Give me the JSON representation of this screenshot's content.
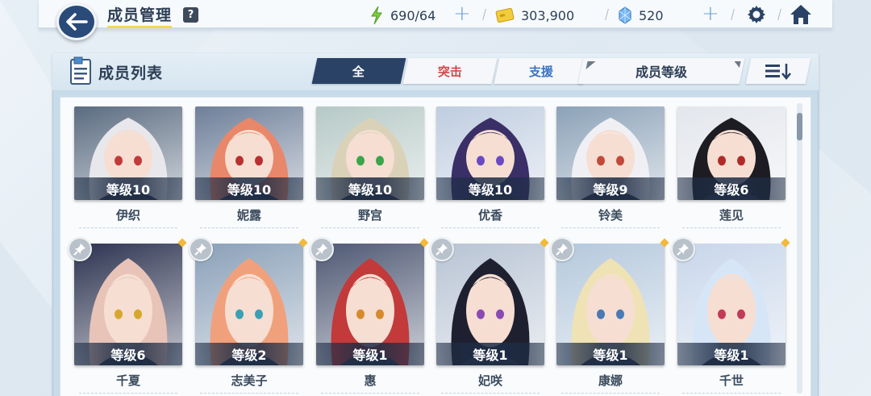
{
  "header": {
    "title": "成员管理",
    "help_label": "?",
    "ap": "690/64",
    "credits": "303,900",
    "gems": "520"
  },
  "panel": {
    "title": "成员列表",
    "tabs": [
      {
        "label": "全"
      },
      {
        "label": "突击"
      },
      {
        "label": "支援"
      }
    ],
    "sort_label": "成员等级"
  },
  "colors": {
    "accent": "#2a4265",
    "striker": "#d14a4a",
    "special": "#3a74c4",
    "badge": "#f2b93a"
  },
  "members": [
    {
      "name": "伊织",
      "level": "等级10",
      "hair": "#e8e8ec",
      "bg": "#5a6b80",
      "eye": "#c23a3a"
    },
    {
      "name": "妮露",
      "level": "等级10",
      "hair": "#e9876a",
      "bg": "#6e7f99",
      "eye": "#b83030"
    },
    {
      "name": "野宫",
      "level": "等级10",
      "hair": "#d9d2b8",
      "bg": "#b6c9c6",
      "eye": "#3aa54a"
    },
    {
      "name": "优香",
      "level": "等级10",
      "hair": "#3b2f68",
      "bg": "#bfcde0",
      "eye": "#6a4ac4"
    },
    {
      "name": "铃美",
      "level": "等级9",
      "hair": "#f0f0f4",
      "bg": "#8ca2b8",
      "eye": "#c24a3a"
    },
    {
      "name": "莲见",
      "level": "等级6",
      "hair": "#1c1c22",
      "bg": "#e3e6ec",
      "eye": "#b02a2a"
    },
    {
      "name": "千夏",
      "level": "等级6",
      "hair": "#e8c3b8",
      "bg": "#2c3350",
      "eye": "#d6a72c"
    },
    {
      "name": "志美子",
      "level": "等级2",
      "hair": "#f1a07c",
      "bg": "#8aa0b8",
      "eye": "#3aa0b4"
    },
    {
      "name": "惠",
      "level": "等级1",
      "hair": "#c23a3a",
      "bg": "#4e5873",
      "eye": "#d68a2c"
    },
    {
      "name": "妃咲",
      "level": "等级1",
      "hair": "#1e2030",
      "bg": "#b8c4d4",
      "eye": "#8a4ab4"
    },
    {
      "name": "康娜",
      "level": "等级1",
      "hair": "#efe2b4",
      "bg": "#b4c8dc",
      "eye": "#4a7ab4"
    },
    {
      "name": "千世",
      "level": "等级1",
      "hair": "#d7e6f6",
      "bg": "#c8d6ea",
      "eye": "#c23a5a"
    }
  ]
}
